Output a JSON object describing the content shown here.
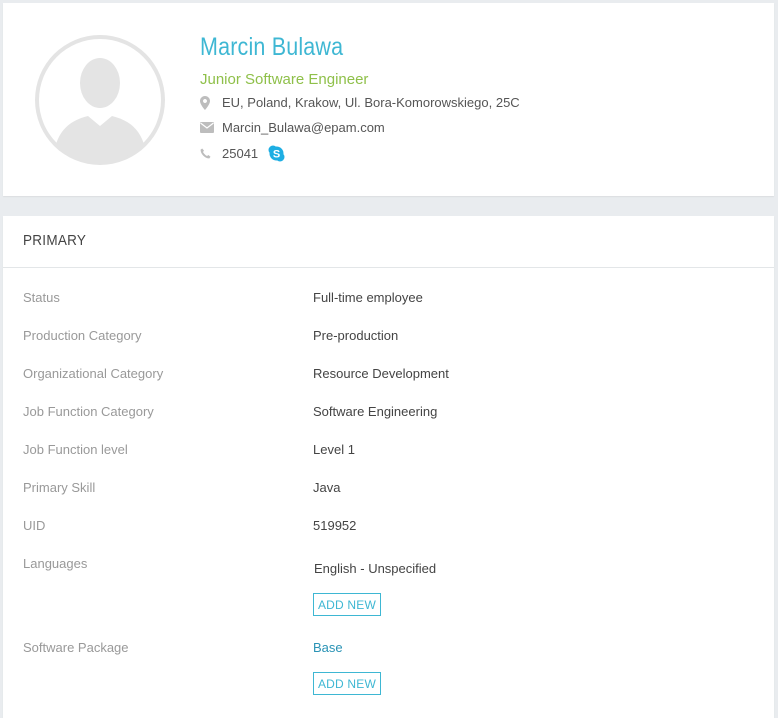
{
  "profile": {
    "name": "Marcin Bulawa",
    "title": "Junior Software Engineer",
    "address": "EU, Poland, Krakow, Ul. Bora-Komorowskiego, 25C",
    "email": "Marcin_Bulawa@epam.com",
    "phone": "25041",
    "icons": [
      "avatar-placeholder",
      "location-pin-icon",
      "envelope-icon",
      "phone-icon",
      "skype-icon"
    ]
  },
  "primary": {
    "title": "PRIMARY",
    "fields": [
      {
        "label": "Status",
        "value": "Full-time employee"
      },
      {
        "label": "Production Category",
        "value": "Pre-production"
      },
      {
        "label": "Organizational Category",
        "value": "Resource Development"
      },
      {
        "label": "Job Function Category",
        "value": "Software Engineering"
      },
      {
        "label": "Job Function level",
        "value": "Level 1"
      },
      {
        "label": "Primary Skill",
        "value": "Java"
      },
      {
        "label": "UID",
        "value": "519952"
      }
    ],
    "languages": {
      "label": "Languages",
      "value": "English - Unspecified",
      "button": "ADD NEW"
    },
    "software_package": {
      "label": "Software Package",
      "value": "Base",
      "button": "ADD NEW"
    }
  },
  "colors": {
    "accent": "#3eb7d3",
    "title_green": "#8fc04a",
    "link": "#2a93b5",
    "label_gray": "#999999",
    "background": "#e9ecef"
  }
}
